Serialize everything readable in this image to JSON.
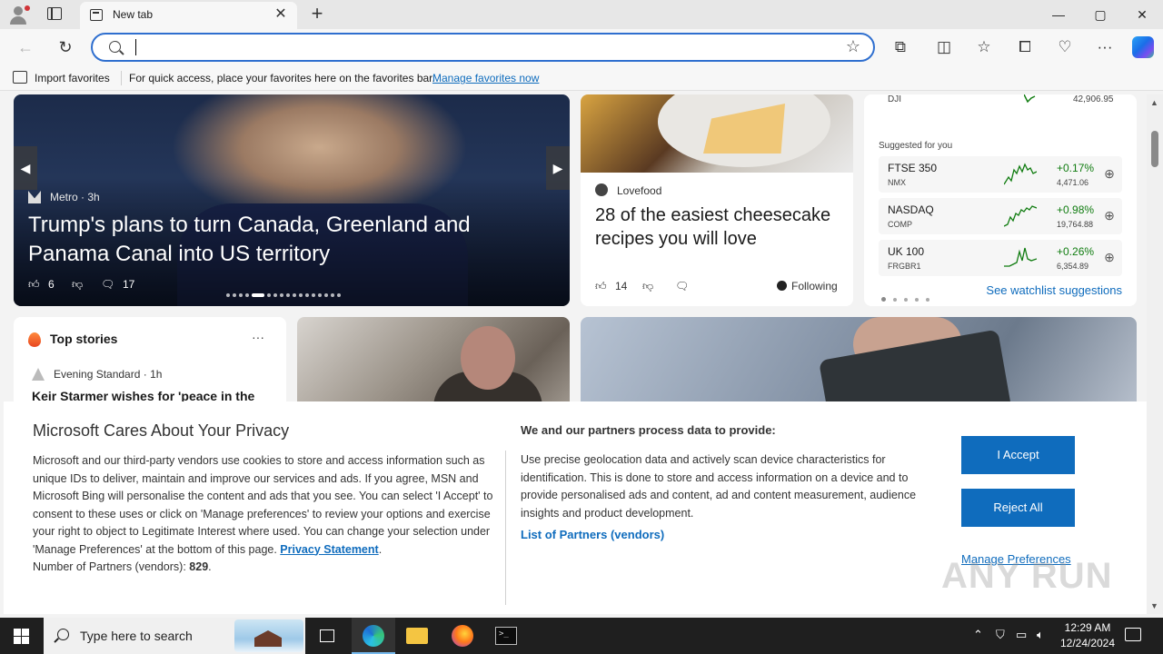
{
  "browser": {
    "tab_title": "New tab",
    "new_tab_glyph": "+",
    "window": {
      "minimize": "—",
      "maximize": "▢",
      "close": "✕"
    },
    "address": {
      "value": "",
      "placeholder": ""
    },
    "favorites_bar": {
      "import_label": "Import favorites",
      "message": "For quick access, place your favorites here on the favorites bar.",
      "manage_link": "Manage favorites now"
    },
    "icons": [
      "profile-icon",
      "tab-actions-icon",
      "back-icon",
      "refresh-icon",
      "search-icon",
      "favorite-star-icon",
      "extensions-icon",
      "split-screen-icon",
      "favorites-icon",
      "collections-icon",
      "browser-essentials-icon",
      "more-icon",
      "copilot-icon"
    ]
  },
  "feed": {
    "hero": {
      "source": "Metro · 3h",
      "headline": "Trump's plans to turn Canada, Greenland and Panama Canal into US territory",
      "likes": "6",
      "comments": "17",
      "prev": "◀",
      "next": "▶"
    },
    "food": {
      "source": "Lovefood",
      "headline": "28 of the easiest cheesecake recipes you will love",
      "likes": "14",
      "following": "Following"
    },
    "watchlist": {
      "top_index": {
        "name": "DJI",
        "value": "42,906.95"
      },
      "suggested_label": "Suggested for you",
      "stocks": [
        {
          "name": "FTSE 350",
          "code": "NMX",
          "change": "+0.17%",
          "price": "4,471.06"
        },
        {
          "name": "NASDAQ",
          "code": "COMP",
          "change": "+0.98%",
          "price": "19,764.88"
        },
        {
          "name": "UK 100",
          "code": "FRGBR1",
          "change": "+0.26%",
          "price": "6,354.89"
        }
      ],
      "suggestions_link": "See watchlist suggestions"
    },
    "top_stories": {
      "title": "Top stories",
      "more": "···",
      "source": "Evening Standard · 1h",
      "headline": "Keir Starmer wishes for 'peace in the"
    }
  },
  "privacy": {
    "title": "Microsoft Cares About Your Privacy",
    "body_before": "Microsoft and our third-party vendors use cookies to store and access information such as unique IDs to deliver, maintain and improve our services and ads. If you agree, MSN and Microsoft Bing will personalise the content and ads that you see. You can select 'I Accept' to consent to these uses or click on 'Manage preferences' to review your options and exercise your right to object to Legitimate Interest where used.  You can change your selection under 'Manage Preferences' at the bottom of this page. ",
    "statement_link": "Privacy Statement",
    "body_after": ".",
    "partners_count_label": "Number of Partners (vendors): ",
    "partners_count": "829",
    "partners_count_end": ".",
    "right_title": "We and our partners process data to provide:",
    "right_body": "Use precise geolocation data and actively scan device characteristics for identification. This is done to store and access information on a device and to provide personalised ads and content, ad and content measurement, audience insights and product development.",
    "partners_link": "List of Partners (vendors)",
    "accept": "I Accept",
    "reject": "Reject All",
    "manage": "Manage Preferences"
  },
  "watermark": "ANY RUN",
  "taskbar": {
    "search_placeholder": "Type here to search",
    "time": "12:29 AM",
    "date": "12/24/2024",
    "apps": [
      "task-view",
      "edge",
      "file-explorer",
      "firefox",
      "terminal"
    ]
  }
}
